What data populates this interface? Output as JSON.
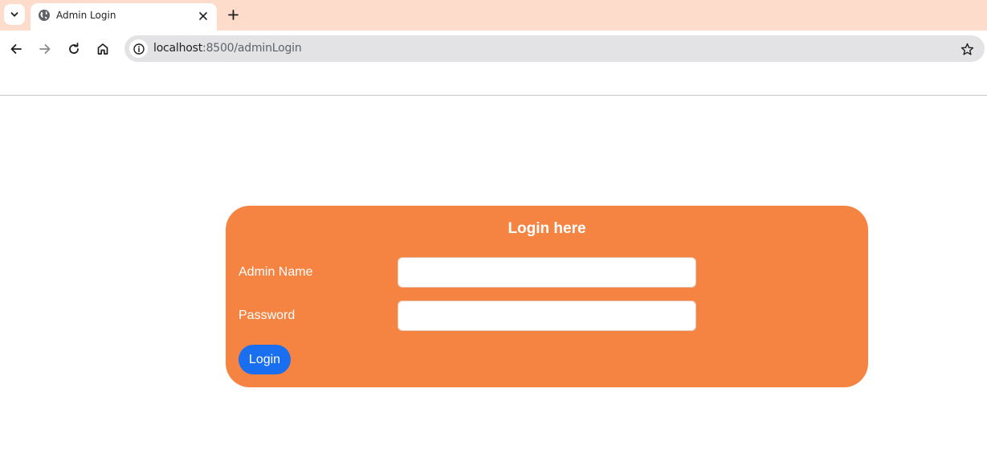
{
  "browser": {
    "tab_title": "Admin Login",
    "url_host": "localhost",
    "url_path": ":8500/adminLogin",
    "tabstrip_color": "#fddccb"
  },
  "icons": {
    "tab_search": "chevron-down-icon",
    "favicon": "globe-icon",
    "tab_close": "close-icon",
    "new_tab": "plus-icon",
    "back": "back-arrow-icon",
    "forward": "forward-arrow-icon",
    "reload": "reload-icon",
    "home": "home-icon",
    "site_info": "info-icon",
    "bookmark": "star-icon"
  },
  "login": {
    "title": "Login here",
    "admin_name_label": "Admin Name",
    "admin_name_value": "",
    "password_label": "Password",
    "password_value": "",
    "button_label": "Login",
    "card_color": "#f58443",
    "button_color": "#1a6ff0"
  }
}
